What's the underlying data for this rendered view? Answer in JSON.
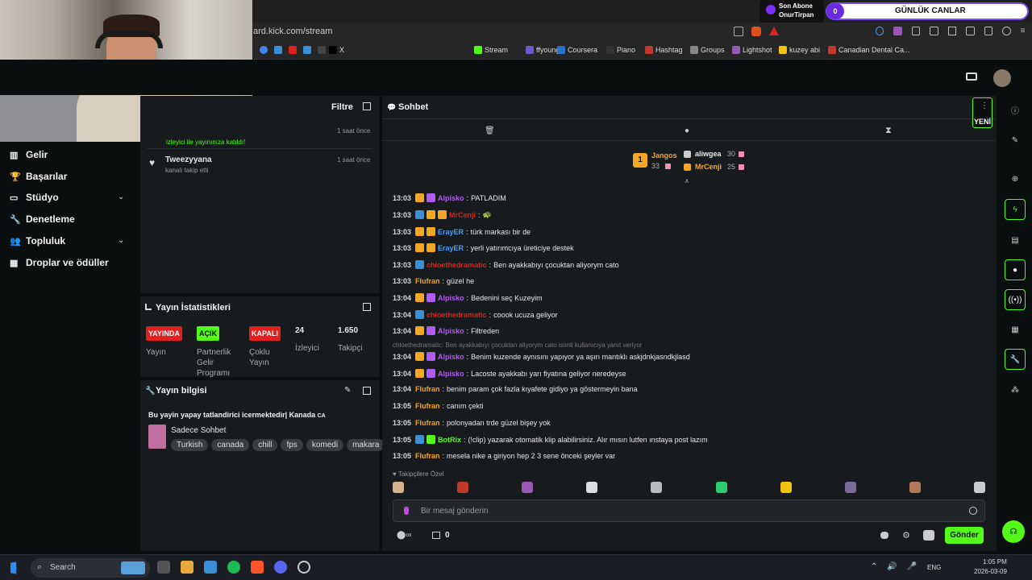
{
  "browser": {
    "url": "ard.kick.com/stream",
    "bookmarks": [
      {
        "label": "X",
        "color": "#000000"
      },
      {
        "label": "Stream",
        "color": "#53fc18"
      },
      {
        "label": "ffyoung",
        "color": "#6a5acd"
      },
      {
        "label": "Coursera",
        "color": "#2a73cc"
      },
      {
        "label": "Piano",
        "color": "#333333"
      },
      {
        "label": "Hashtag",
        "color": "#c0392b"
      },
      {
        "label": "Groups",
        "color": "#888888"
      },
      {
        "label": "Lightshot",
        "color": "#9b59b6"
      },
      {
        "label": "kuzey abi",
        "color": "#f1c40f"
      },
      {
        "label": "Canadian Dental Ca...",
        "color": "#c0392b"
      }
    ]
  },
  "overlay": {
    "sub_label": "Son Abone",
    "sub_name": "OnurTirpan",
    "goal_count": "0",
    "goal_title": "GÜNLÜK CANLAR"
  },
  "sidebar": {
    "items": [
      {
        "label": "Gelir",
        "icon": "chart-icon"
      },
      {
        "label": "Başarılar",
        "icon": "trophy-icon"
      },
      {
        "label": "Stüdyo",
        "icon": "studio-icon",
        "chevron": true
      },
      {
        "label": "Denetleme",
        "icon": "wrench-icon"
      },
      {
        "label": "Topluluk",
        "icon": "people-icon",
        "chevron": true
      },
      {
        "label": "Droplar ve ödüller",
        "icon": "drops-icon"
      }
    ]
  },
  "activity": {
    "filter_label": "Filtre",
    "items": [
      {
        "name": "",
        "desc": "izleyici ile yayınınıza katıldı!",
        "time": "1 saat önce"
      },
      {
        "name": "Tweezyyana",
        "desc": "kanalı takip etti",
        "time": "1 saat önce"
      }
    ]
  },
  "stats": {
    "title": "Yayın İstatistikleri",
    "badges": [
      {
        "text": "YAYINDA",
        "label": "Yayın",
        "bg": "#e0201f",
        "fg": "#ffffff"
      },
      {
        "text": "AÇIK",
        "label": "Partnerlik Gelir Programı",
        "bg": "#53fc18",
        "fg": "#0b0e0f"
      },
      {
        "text": "KAPALI",
        "label": "Çoklu Yayın",
        "bg": "#e0201f",
        "fg": "#ffffff"
      }
    ],
    "viewers_value": "24",
    "viewers_label": "İzleyici",
    "followers_value": "1.650",
    "followers_label": "Takipçi"
  },
  "info": {
    "title": "Yayın bilgisi",
    "stream_title": "Bu yayin yapay tatlandirici icermektedir| Kanada",
    "stream_title_flag": "CA",
    "category": "Sadece Sohbet",
    "tags": [
      "Turkish",
      "canada",
      "chill",
      "fps",
      "komedi",
      "makara"
    ]
  },
  "chat": {
    "title": "Sohbet",
    "yeni": "YENİ",
    "leaderboard": [
      {
        "name": "Jangos",
        "count": "33",
        "rank": "1",
        "color": "#f5a623"
      },
      {
        "name": "aliwgea",
        "count": "30",
        "color": "#e8e8e8"
      },
      {
        "name": "MrCenji",
        "count": "25",
        "color": "#f5a623"
      }
    ],
    "messages": [
      {
        "time": "13:03",
        "badges": [
          "#f5a623",
          "#b05cf0"
        ],
        "user": "Alpisko",
        "color": "#b05cf0",
        "text": "PATLADIM"
      },
      {
        "time": "13:03",
        "badges": [
          "#3a8fd6",
          "#f5a623",
          "#f5a623"
        ],
        "user": "MrCenji",
        "color": "#e0201f",
        "text": "🐢"
      },
      {
        "time": "13:03",
        "badges": [
          "#f5a623",
          "#f5a623"
        ],
        "user": "ErayER",
        "color": "#4a9ff5",
        "text": "türk markası bir de"
      },
      {
        "time": "13:03",
        "badges": [
          "#f5a623",
          "#f5a623"
        ],
        "user": "ErayER",
        "color": "#4a9ff5",
        "text": "yerli yatırımcıya üreticiye destek"
      },
      {
        "time": "13:03",
        "badges": [
          "#3a8fd6"
        ],
        "user": "chloethedramatic",
        "color": "#e0201f",
        "text": "Ben ayakkabıyı çocuktan aliyorym cato"
      },
      {
        "time": "13:03",
        "badges": [],
        "user": "Flufran",
        "color": "#f5a623",
        "text": "güzel he"
      },
      {
        "time": "13:04",
        "badges": [
          "#f5a623",
          "#b05cf0"
        ],
        "user": "Alpisko",
        "color": "#b05cf0",
        "text": "Bedenini seç Kuzeyim"
      },
      {
        "time": "13:04",
        "badges": [
          "#3a8fd6"
        ],
        "user": "chloethedramatic",
        "color": "#e0201f",
        "text": "coook ucuza geliyor"
      },
      {
        "time": "13:04",
        "badges": [
          "#f5a623",
          "#b05cf0"
        ],
        "user": "Alpisko",
        "color": "#b05cf0",
        "text": "Filtreden"
      },
      {
        "time": "13:04",
        "badges": [
          "#f5a623",
          "#b05cf0"
        ],
        "user": "Alpisko",
        "color": "#b05cf0",
        "text": "Benim kuzende aynısını yapıyor ya aşırı mantıklı askjdnkjasndkjlasd",
        "reply": "chloethedramatic: Ben ayakkabıyı çocuktan aliyorym cato isimli kullanıcıya yanıt veriyor"
      },
      {
        "time": "13:04",
        "badges": [
          "#f5a623",
          "#b05cf0"
        ],
        "user": "Alpisko",
        "color": "#b05cf0",
        "text": "Lacoste ayakkabı yarı fiyatına geliyor neredeyse"
      },
      {
        "time": "13:04",
        "badges": [],
        "user": "Flufran",
        "color": "#f5a623",
        "text": "benim param çok fazla kıyafete gidiyo ya göstermeyin bana"
      },
      {
        "time": "13:05",
        "badges": [],
        "user": "Flufran",
        "color": "#f5a623",
        "text": "canım çekti"
      },
      {
        "time": "13:05",
        "badges": [],
        "user": "Flufran",
        "color": "#f5a623",
        "text": "polonyadan trde güzel bişey yok"
      },
      {
        "time": "13:05",
        "badges": [
          "#3a8fd6",
          "#53fc18"
        ],
        "user": "BotRix",
        "color": "#53fc18",
        "text": "(!clip) yazarak otomatik klip alabilirsiniz. Alır mısın lutfen ınstaya post lazım"
      },
      {
        "time": "13:05",
        "badges": [],
        "user": "Flufran",
        "color": "#f5a623",
        "text": "mesela nike a giriyon hep 2 3 sene önceki şeyler var"
      }
    ],
    "followers_only": "Takipçilere Özel",
    "input_placeholder": "Bir mesaj gönderin",
    "points": "0",
    "send_label": "Gönder"
  },
  "taskbar": {
    "search": "Search",
    "lang": "ENG",
    "time": "1:05 PM",
    "date": "2026-03-09"
  }
}
